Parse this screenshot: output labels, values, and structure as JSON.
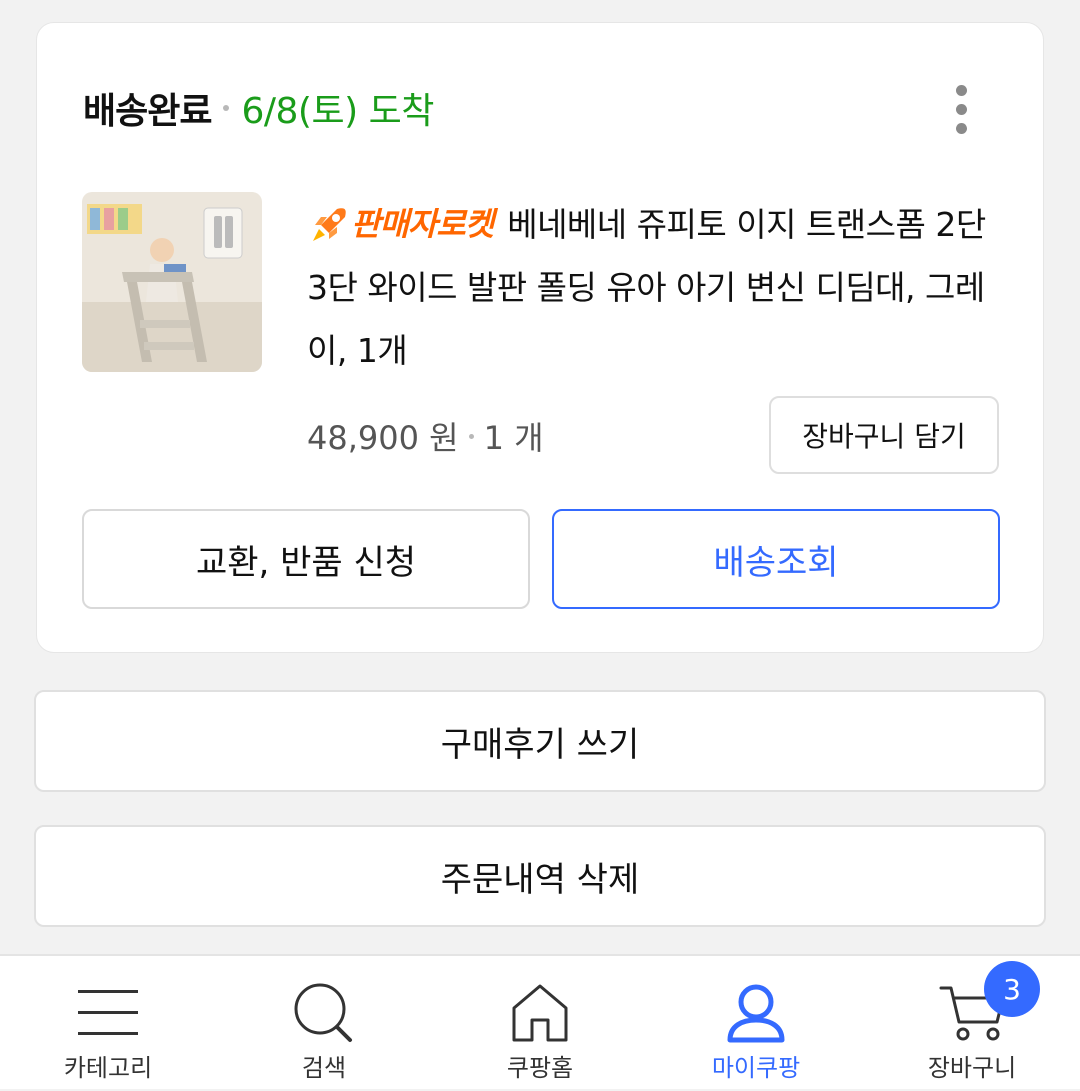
{
  "order": {
    "status": "배송완료",
    "arrival": "6/8(토) 도착",
    "badge_text": "판매자로켓",
    "product_title": "베네베네 쥬피토 이지 트랜스폼 2단 3단 와이드 발판 폴딩 유아 아기 변신 디딤대, 그레이, 1개",
    "price": "48,900 원",
    "quantity": "1 개",
    "add_to_cart_label": "장바구니 담기",
    "exchange_return_label": "교환, 반품 신청",
    "track_delivery_label": "배송조회"
  },
  "actions": {
    "write_review_label": "구매후기 쓰기",
    "delete_order_label": "주문내역 삭제"
  },
  "bottom_nav": {
    "items": [
      {
        "label": "카테고리",
        "icon": "menu-icon"
      },
      {
        "label": "검색",
        "icon": "search-icon"
      },
      {
        "label": "쿠팡홈",
        "icon": "home-icon"
      },
      {
        "label": "마이쿠팡",
        "icon": "user-icon",
        "active": true
      },
      {
        "label": "장바구니",
        "icon": "cart-icon"
      }
    ],
    "cart_count": "3"
  },
  "colors": {
    "accent": "#346aff",
    "arrival_green": "#1a9c1a",
    "rocket_orange": "#ff6600"
  }
}
